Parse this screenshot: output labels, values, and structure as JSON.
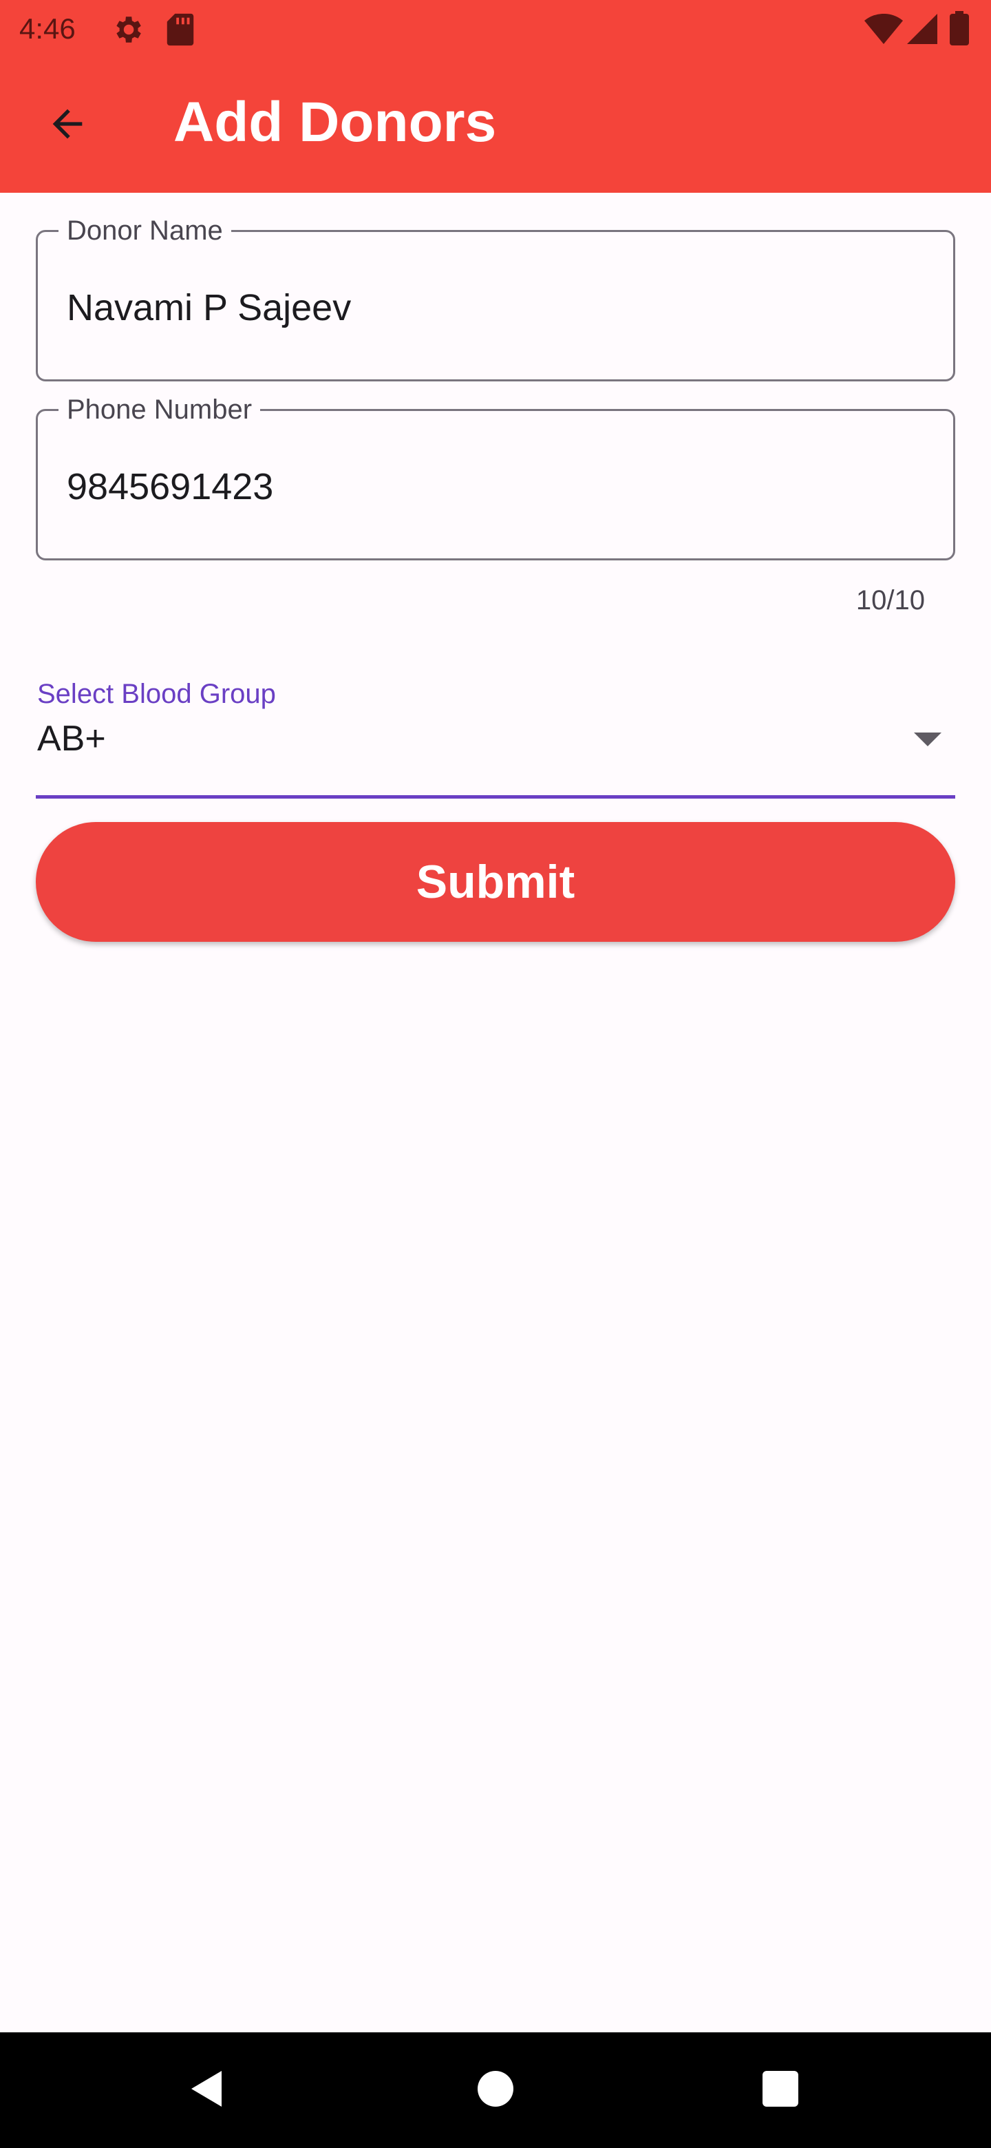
{
  "status_bar": {
    "time": "4:46",
    "icons": [
      "gear-icon",
      "sd-card-icon",
      "wifi-icon",
      "signal-icon",
      "battery-icon"
    ]
  },
  "app_bar": {
    "title": "Add Donors",
    "back_icon": "arrow-back-icon",
    "background": "#f4443a"
  },
  "form": {
    "donor_name": {
      "label": "Donor Name",
      "value": "Navami P Sajeev"
    },
    "phone_number": {
      "label": "Phone Number",
      "value": "9845691423",
      "counter": "10/10"
    },
    "blood_group": {
      "label": "Select Blood Group",
      "selected": "AB+"
    },
    "submit_label": "Submit"
  },
  "nav_bar": {
    "buttons": [
      "back-triangle-icon",
      "home-circle-icon",
      "recents-square-icon"
    ]
  },
  "colors": {
    "primary": "#f4443a",
    "button": "#ee4340",
    "accent": "#6a3fc4",
    "background": "#fffbfe"
  }
}
